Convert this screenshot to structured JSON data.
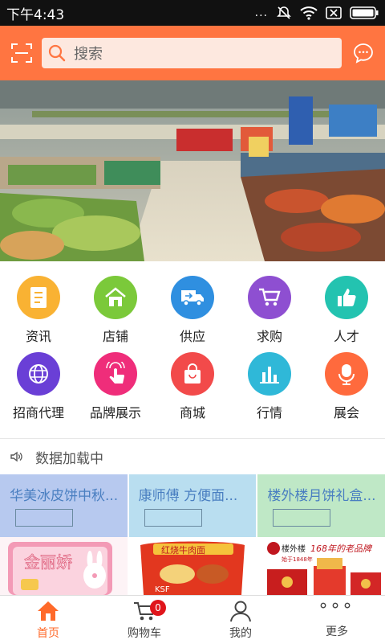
{
  "status_bar": {
    "time": "下午4:43",
    "dots": "..."
  },
  "header": {
    "search_placeholder": "搜索"
  },
  "categories": [
    {
      "label": "资讯",
      "color": "#f9b233",
      "icon": "news-icon"
    },
    {
      "label": "店铺",
      "color": "#7bc93a",
      "icon": "store-icon"
    },
    {
      "label": "供应",
      "color": "#2f8fe0",
      "icon": "truck-icon"
    },
    {
      "label": "求购",
      "color": "#8e4fd1",
      "icon": "cart-icon"
    },
    {
      "label": "人才",
      "color": "#23c3b0",
      "icon": "thumbs-up-icon"
    },
    {
      "label": "招商代理",
      "color": "#6a3fd6",
      "icon": "globe-icon"
    },
    {
      "label": "品牌展示",
      "color": "#ef2d7a",
      "icon": "touch-icon"
    },
    {
      "label": "商城",
      "color": "#f24a4a",
      "icon": "shopping-bag-icon"
    },
    {
      "label": "行情",
      "color": "#2fb8d8",
      "icon": "bar-chart-icon"
    },
    {
      "label": "展会",
      "color": "#ff6a3d",
      "icon": "microphone-icon"
    }
  ],
  "notice": {
    "text": "数据加载中"
  },
  "products": [
    {
      "title": "华美冰皮饼中秋...",
      "bg": "#b7c9ef"
    },
    {
      "title": "康师傅 方便面...",
      "bg": "#b9def0"
    },
    {
      "title": "楼外楼月饼礼盒...",
      "bg": "#bfe8c6"
    }
  ],
  "product_images": [
    {
      "text": "金丽娇"
    },
    {
      "text": "红烧牛肉面"
    },
    {
      "brand": "楼外楼",
      "slogan": "168年的老品牌",
      "sub": "始于1848年"
    }
  ],
  "tabbar": {
    "tabs": [
      {
        "label": "首页",
        "icon": "home-icon",
        "active": true
      },
      {
        "label": "购物车",
        "icon": "cart-icon",
        "badge": "0"
      },
      {
        "label": "我的",
        "icon": "user-icon"
      },
      {
        "label": "更多",
        "icon": "more-dots-icon",
        "dots": "°°°"
      }
    ]
  },
  "colors": {
    "accent": "#ff7541",
    "status_bar": "#111111"
  }
}
